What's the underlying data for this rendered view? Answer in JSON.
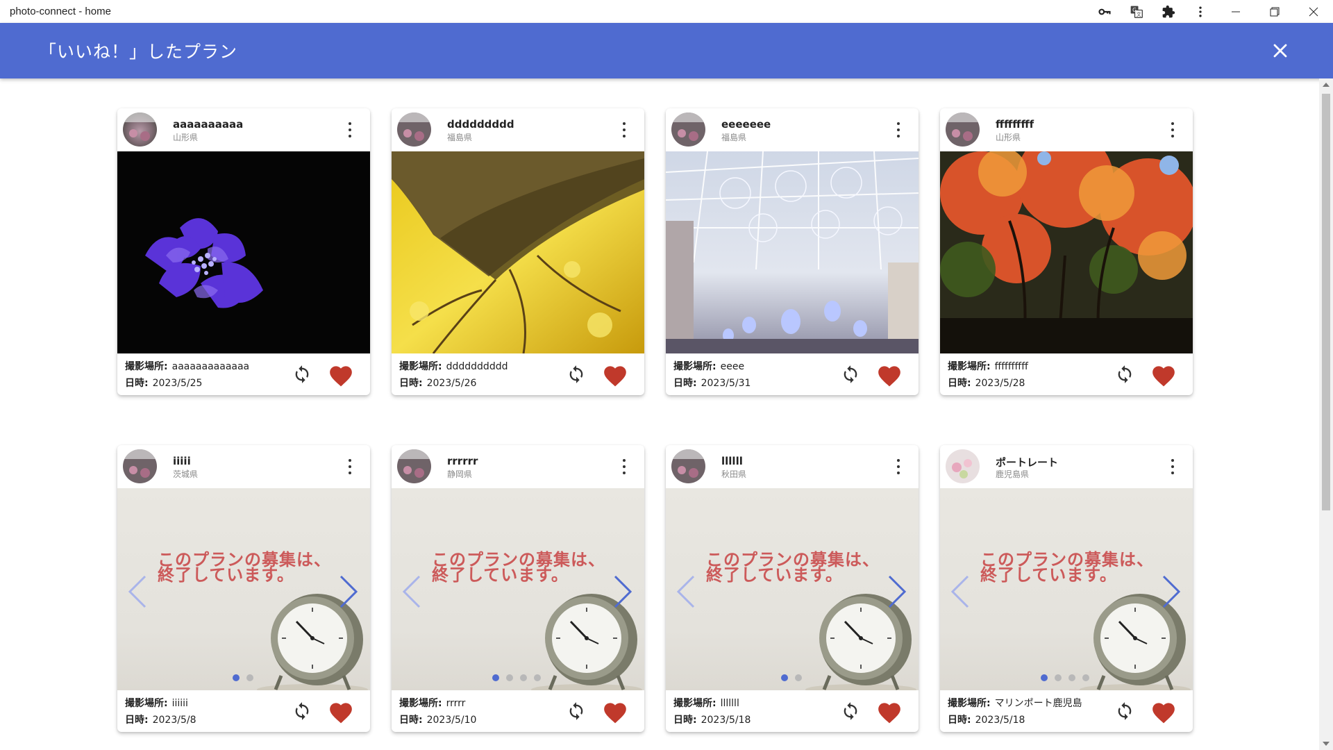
{
  "window": {
    "title": "photo-connect - home",
    "ext_icons": [
      "key-icon",
      "translate-icon",
      "puzzle-icon",
      "more-vert-icon"
    ],
    "controls": [
      "minimize-icon",
      "restore-icon",
      "close-icon"
    ]
  },
  "header": {
    "title": "「いいね！」したプラン",
    "accent": "#4f6bd0"
  },
  "labels": {
    "location": "撮影場所:",
    "date": "日時:"
  },
  "ended_message": {
    "line1": "このプランの募集は、",
    "line2": "終了しています。"
  },
  "colors": {
    "heart": "#c0392b",
    "ended_text": "#cc5a5a",
    "dot_active": "#4f6bd0",
    "dot_inactive": "#b8b8b8"
  },
  "cards": [
    {
      "user": "aaaaaaaaaa",
      "prefecture": "山形県",
      "location": "aaaaaaaaaaaaa",
      "date": "2023/5/25",
      "photo": "hydrangea"
    },
    {
      "user": "ddddddddd",
      "prefecture": "福島県",
      "location": "dddddddddd",
      "date": "2023/5/26",
      "photo": "ginkgo"
    },
    {
      "user": "eeeeeee",
      "prefecture": "福島県",
      "location": "eeee",
      "date": "2023/5/31",
      "photo": "illumination"
    },
    {
      "user": "fffffffff",
      "prefecture": "山形県",
      "location": "ffffffffff",
      "date": "2023/5/28",
      "photo": "autumn"
    },
    {
      "user": "iiiii",
      "prefecture": "茨城県",
      "location": "iiiiii",
      "date": "2023/5/8",
      "photo": "ended",
      "dot_count": 2
    },
    {
      "user": "rrrrrr",
      "prefecture": "静岡県",
      "location": "rrrrr",
      "date": "2023/5/10",
      "photo": "ended",
      "dot_count": 4
    },
    {
      "user": "llllll",
      "prefecture": "秋田県",
      "location": "lllllll",
      "date": "2023/5/18",
      "photo": "ended",
      "dot_count": 2
    },
    {
      "user": "ポートレート",
      "prefecture": "鹿児島県",
      "location": "マリンポート鹿児島",
      "date": "2023/5/18",
      "photo": "ended",
      "dot_count": 4
    }
  ]
}
